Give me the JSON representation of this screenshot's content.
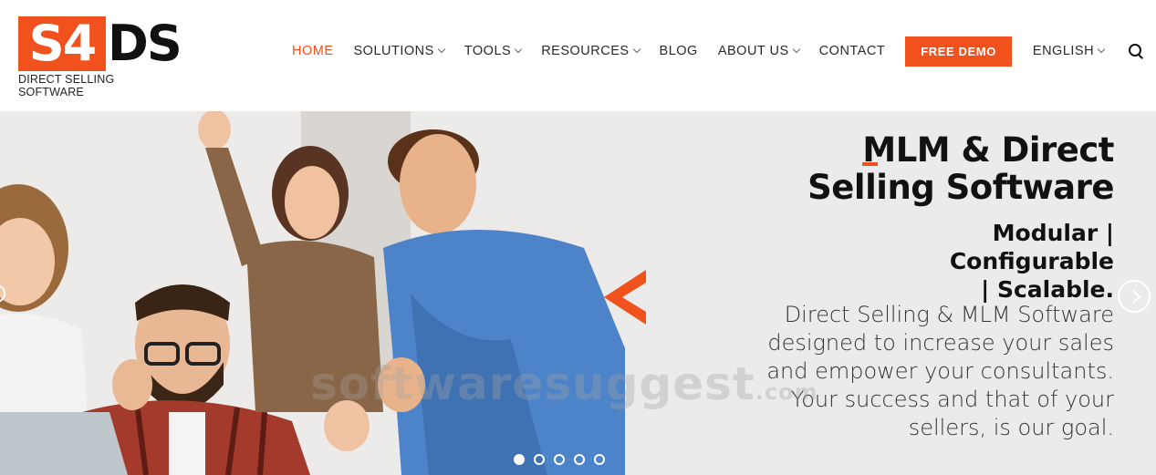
{
  "logo": {
    "mark_left": "S4",
    "mark_right": "DS",
    "tagline": "DIRECT SELLING SOFTWARE"
  },
  "nav": {
    "items": [
      {
        "label": "HOME",
        "active": true,
        "dropdown": false
      },
      {
        "label": "SOLUTIONS",
        "active": false,
        "dropdown": true
      },
      {
        "label": "TOOLS",
        "active": false,
        "dropdown": true
      },
      {
        "label": "RESOURCES",
        "active": false,
        "dropdown": true
      },
      {
        "label": "BLOG",
        "active": false,
        "dropdown": false
      },
      {
        "label": "ABOUT US",
        "active": false,
        "dropdown": true
      },
      {
        "label": "CONTACT",
        "active": false,
        "dropdown": false
      }
    ],
    "demo_button": "FREE DEMO",
    "language": "ENGLISH",
    "search_icon": "search-icon"
  },
  "hero": {
    "heading_line1": "MLM & Direct",
    "heading_line2": "Selling Software",
    "subheading_line1": "Modular | Configurable",
    "subheading_line2": "| Scalable.",
    "description_lines": [
      "Direct Selling & MLM Software",
      "designed to increase your sales",
      "and empower your consultants.",
      "Your success and that of your",
      "sellers, is our goal."
    ],
    "watermark": "softwaresuggest",
    "watermark_suffix": ".com",
    "slide_count": 5,
    "active_slide": 1
  },
  "colors": {
    "accent": "#f0511d",
    "text": "#111111",
    "panel": "#ebebeb"
  }
}
